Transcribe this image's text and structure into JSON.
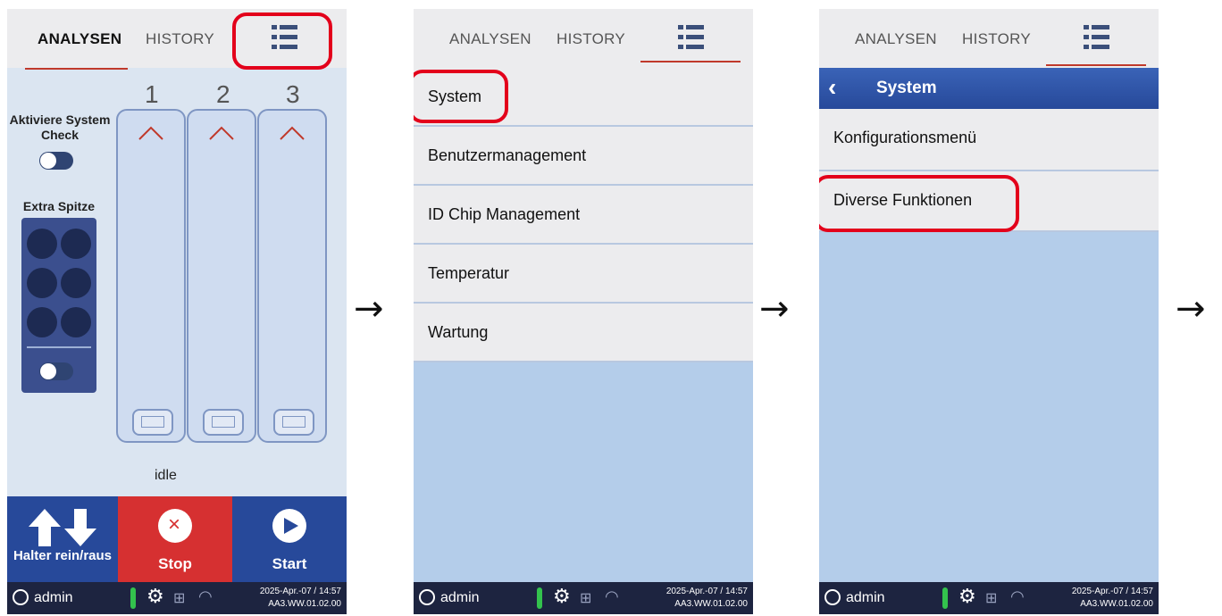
{
  "tabs": {
    "analysen": "ANALYSEN",
    "history": "HISTORY"
  },
  "arrow": "→",
  "screen1": {
    "slots": [
      "1",
      "2",
      "3"
    ],
    "system_check_label": "Aktiviere System Check",
    "extra_tip_label": "Extra Spitze",
    "status_text": "idle",
    "buttons": {
      "halter": "Halter rein/raus",
      "stop": "Stop",
      "start": "Start"
    }
  },
  "screen2": {
    "menu": [
      "System",
      "Benutzermanagement",
      "ID Chip Management",
      "Temperatur",
      "Wartung"
    ]
  },
  "screen3": {
    "header": "System",
    "menu": [
      "Konfigurationsmenü",
      "Diverse Funktionen"
    ]
  },
  "statusbar": {
    "user": "admin",
    "datetime": "2025-Apr.-07 / 14:57",
    "version": "AA3.WW.01.02.00"
  },
  "colors": {
    "highlight": "#e3001b",
    "accent_blue": "#27499a",
    "stop_red": "#d63031",
    "status_bg": "#1d2440"
  }
}
